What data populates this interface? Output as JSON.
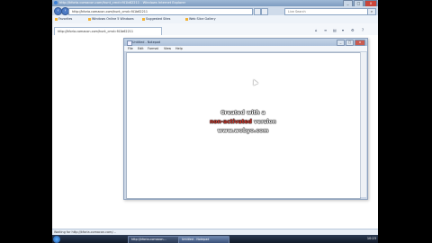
{
  "browser": {
    "title": "http://kforia.comacon.com/hunt_cmd=f41b62211 - Windows Internet Explorer",
    "address": "http://kforia.comacon.com/hunt_cmd=f41b62211",
    "search_placeholder": "Live Search",
    "favorites": [
      {
        "label": "Favorites"
      },
      {
        "label": "Windows Online 5 Windows"
      },
      {
        "label": "Suggested Sites"
      },
      {
        "label": "Web Slice Gallery"
      }
    ],
    "tab_label": "http://kforia.comacon.com/hunt_cmd=f41b62211",
    "window_buttons": {
      "minimize": "_",
      "maximize": "□",
      "close": "x"
    },
    "status": "Waiting for http://kforia.comacon.com/..."
  },
  "notepad": {
    "title": "Untitled - Notepad",
    "menu": [
      "File",
      "Edit",
      "Format",
      "View",
      "Help"
    ],
    "window_buttons": {
      "minimize": "_",
      "maximize": "□",
      "close": "x"
    }
  },
  "watermark": {
    "line1": "Created with a",
    "line2_red": "non-activated",
    "line2_rest": " version",
    "line3": "www.wobyo.com"
  },
  "taskbar": {
    "buttons": [
      "http://kforia.comacon...",
      "Untitled - Notepad"
    ],
    "clock": "10:23"
  },
  "colors": {
    "accent": "#4d7bc4",
    "watermark_red": "#d43a2e"
  }
}
